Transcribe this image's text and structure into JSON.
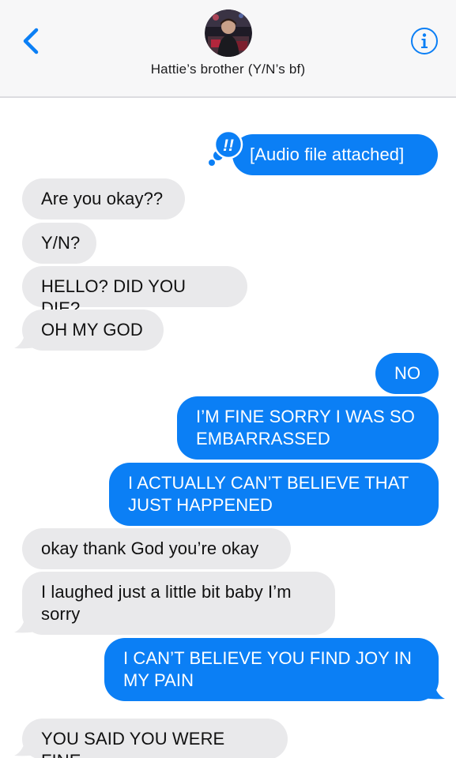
{
  "header": {
    "contact_name": "Hattie’s brother (Y/N’s bf)",
    "back_icon": "chevron-left-icon",
    "info_icon": "info-icon",
    "accent_color": "#0b7ff5"
  },
  "messages": [
    {
      "direction": "outgoing",
      "text": "[Audio file attached]",
      "effect": "!!"
    },
    {
      "direction": "incoming",
      "text": "Are you okay??"
    },
    {
      "direction": "incoming",
      "text": "Y/N?"
    },
    {
      "direction": "incoming",
      "text": "HELLO? DID YOU DIE?"
    },
    {
      "direction": "incoming",
      "text": "OH MY GOD"
    },
    {
      "direction": "outgoing",
      "text": "NO"
    },
    {
      "direction": "outgoing",
      "text": "I’M FINE SORRY I WAS SO EMBARRASSED"
    },
    {
      "direction": "outgoing",
      "text": "I ACTUALLY CAN’T BELIEVE THAT JUST HAPPENED"
    },
    {
      "direction": "incoming",
      "text": "okay thank God you’re okay"
    },
    {
      "direction": "incoming",
      "text": "I laughed just a little bit baby I’m sorry"
    },
    {
      "direction": "outgoing",
      "text": "I CAN’T BELIEVE YOU FIND JOY IN MY PAIN"
    },
    {
      "direction": "incoming",
      "text": "YOU SAID YOU WERE FINE"
    }
  ],
  "colors": {
    "incoming_bubble": "#e9e9eb",
    "outgoing_bubble": "#0b7ff5"
  }
}
